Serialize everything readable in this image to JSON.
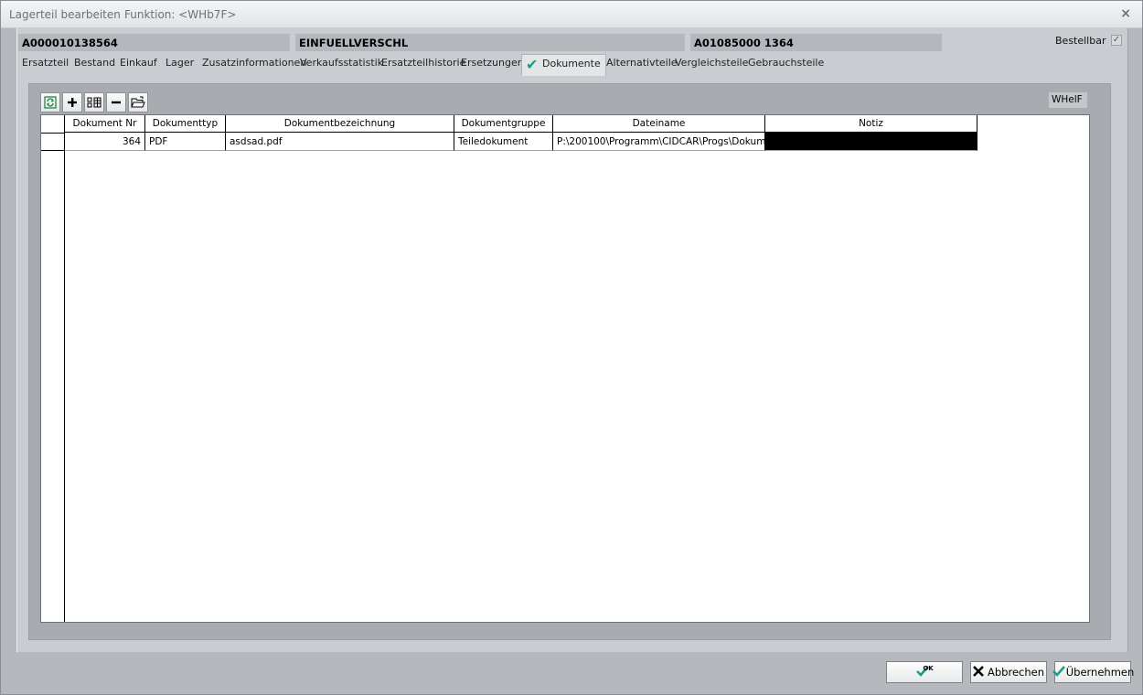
{
  "window": {
    "title": "Lagerteil bearbeiten",
    "function": "Funktion: <WHb7F>",
    "close_glyph": "×"
  },
  "header": {
    "part_number": "A000010138564",
    "description": "EINFUELLVERSCHL",
    "ref": "A01085000  1364",
    "bestellbar_label": "Bestellbar",
    "bestellbar_checked": true
  },
  "tabs": [
    {
      "label": "Ersatzteil"
    },
    {
      "label": "Bestand"
    },
    {
      "label": "Einkauf"
    },
    {
      "label": "Lager"
    },
    {
      "label": "Zusatzinformationen"
    },
    {
      "label": "Verkaufsstatistik"
    },
    {
      "label": "Ersatzteilhistorie"
    },
    {
      "label": "Ersetzungen"
    },
    {
      "label": "Dokumente",
      "active": true
    },
    {
      "label": "Alternativteile"
    },
    {
      "label": "Vergleichsteile"
    },
    {
      "label": "Gebrauchsteile"
    }
  ],
  "panel": {
    "whelf_label": "WHelF"
  },
  "table": {
    "columns": [
      "Dokument Nr",
      "Dokumenttyp",
      "Dokumentbezeichnung",
      "Dokumentgruppe",
      "Dateiname",
      "Notiz"
    ],
    "rows": [
      [
        "364",
        "PDF",
        "asdsad.pdf",
        "Teiledokument",
        "P:\\200100\\Programm\\CIDCAR\\Progs\\Dokum",
        ""
      ]
    ]
  },
  "buttons": {
    "ok_label": "OK",
    "cancel_label": "Abbrechen",
    "apply_label": "Übernehmen"
  }
}
